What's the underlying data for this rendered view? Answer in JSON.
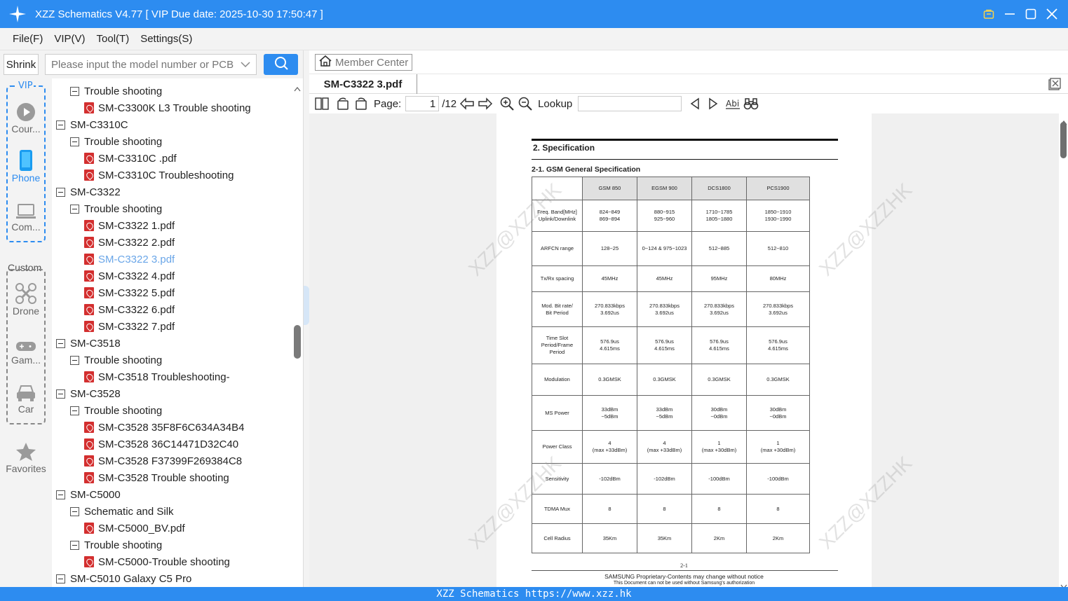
{
  "app": {
    "title": "XZZ Schematics V4.77 [ VIP Due date: 2025-10-30 17:50:47 ]"
  },
  "menu": [
    "File(F)",
    "VIP(V)",
    "Tool(T)",
    "Settings(S)"
  ],
  "search": {
    "shrink_label": "Shrink",
    "placeholder": "Please input the model number or PCB"
  },
  "sidebar": {
    "vip_label": "VIP",
    "custom_label": "Custom",
    "items": [
      {
        "label": "Cour...",
        "icon": "play-icon"
      },
      {
        "label": "Phone",
        "icon": "phone-icon"
      },
      {
        "label": "Com...",
        "icon": "laptop-icon"
      },
      {
        "label": "Drone",
        "icon": "drone-icon"
      },
      {
        "label": "Gam...",
        "icon": "gamepad-icon"
      },
      {
        "label": "Car",
        "icon": "car-icon"
      },
      {
        "label": "Favorites",
        "icon": "star-icon"
      }
    ]
  },
  "tree": [
    {
      "level": 1,
      "type": "folder",
      "label": "Trouble shooting"
    },
    {
      "level": 2,
      "type": "pdf",
      "label": "SM-C3300K L3 Trouble shooting"
    },
    {
      "level": 0,
      "type": "folder",
      "label": "SM-C3310C"
    },
    {
      "level": 1,
      "type": "folder",
      "label": "Trouble shooting"
    },
    {
      "level": 2,
      "type": "pdf",
      "label": "SM-C3310C .pdf"
    },
    {
      "level": 2,
      "type": "pdf",
      "label": "SM-C3310C Troubleshooting"
    },
    {
      "level": 0,
      "type": "folder",
      "label": "SM-C3322"
    },
    {
      "level": 1,
      "type": "folder",
      "label": "Trouble shooting"
    },
    {
      "level": 2,
      "type": "pdf",
      "label": "SM-C3322 1.pdf"
    },
    {
      "level": 2,
      "type": "pdf",
      "label": "SM-C3322 2.pdf"
    },
    {
      "level": 2,
      "type": "pdf",
      "label": "SM-C3322 3.pdf",
      "selected": true
    },
    {
      "level": 2,
      "type": "pdf",
      "label": "SM-C3322 4.pdf"
    },
    {
      "level": 2,
      "type": "pdf",
      "label": "SM-C3322 5.pdf"
    },
    {
      "level": 2,
      "type": "pdf",
      "label": "SM-C3322 6.pdf"
    },
    {
      "level": 2,
      "type": "pdf",
      "label": "SM-C3322 7.pdf"
    },
    {
      "level": 0,
      "type": "folder",
      "label": "SM-C3518"
    },
    {
      "level": 1,
      "type": "folder",
      "label": "Trouble shooting"
    },
    {
      "level": 2,
      "type": "pdf",
      "label": "SM-C3518 Troubleshooting-"
    },
    {
      "level": 0,
      "type": "folder",
      "label": "SM-C3528"
    },
    {
      "level": 1,
      "type": "folder",
      "label": "Trouble shooting"
    },
    {
      "level": 2,
      "type": "pdf",
      "label": "SM-C3528 35F8F6C634A34B4"
    },
    {
      "level": 2,
      "type": "pdf",
      "label": "SM-C3528 36C14471D32C40"
    },
    {
      "level": 2,
      "type": "pdf",
      "label": "SM-C3528 F37399F269384C8"
    },
    {
      "level": 2,
      "type": "pdf",
      "label": "SM-C3528 Trouble shooting"
    },
    {
      "level": 0,
      "type": "folder",
      "label": "SM-C5000"
    },
    {
      "level": 1,
      "type": "folder",
      "label": "Schematic and Silk"
    },
    {
      "level": 2,
      "type": "pdf",
      "label": "SM-C5000_BV.pdf"
    },
    {
      "level": 1,
      "type": "folder",
      "label": "Trouble shooting"
    },
    {
      "level": 2,
      "type": "pdf",
      "label": "SM-C5000-Trouble shooting"
    },
    {
      "level": 0,
      "type": "folder",
      "label": "SM-C5010 Galaxy C5 Pro"
    }
  ],
  "viewer": {
    "member_center": "Member Center",
    "tab_name": "SM-C3322 3.pdf",
    "page_label": "Page:",
    "page_current": "1",
    "page_total": "/12",
    "lookup_label": "Lookup"
  },
  "document": {
    "section": "2.  Specification",
    "subsection": "2-1.  GSM  General  Specification",
    "columns": [
      "",
      "GSM  850",
      "EGSM  900",
      "DCS1800",
      "PCS1900"
    ],
    "rows": [
      [
        "Freq.  Band[MHz]\nUplink/Downlink",
        "824~849\n869~894",
        "880~915\n925~960",
        "1710~1785\n1805~1880",
        "1850~1910\n1930~1990"
      ],
      [
        "ARFCN  range",
        "128~25",
        "0~124  &  975~1023",
        "512~885",
        "512~810"
      ],
      [
        "Tx/Rx  spacing",
        "45MHz",
        "45MHz",
        "95MHz",
        "80MHz"
      ],
      [
        "Mod.  Bit  rate/\nBit  Period",
        "270.833kbps\n3.692us",
        "270.833kbps\n3.692us",
        "270.833kbps\n3.692us",
        "270.833kbps\n3.692us"
      ],
      [
        "Time  Slot\nPeriod/Frame\nPeriod",
        "576.9us\n4.615ms",
        "576.9us\n4.615ms",
        "576.9us\n4.615ms",
        "576.9us\n4.615ms"
      ],
      [
        "Modulation",
        "0.3GMSK",
        "0.3GMSK",
        "0.3GMSK",
        "0.3GMSK"
      ],
      [
        "MS  Power",
        "33dBm\n~5dBm",
        "33dBm\n~5dBm",
        "30dBm\n~0dBm",
        "30dBm\n~0dBm"
      ],
      [
        "Power  Class",
        "4\n(max  +33dBm)",
        "4\n(max  +33dBm)",
        "1\n(max  +30dBm)",
        "1\n(max  +30dBm)"
      ],
      [
        "Sensitivity",
        "-102dBm",
        "-102dBm",
        "-100dBm",
        "-100dBm"
      ],
      [
        "TDMA  Mux",
        "8",
        "8",
        "8",
        "8"
      ],
      [
        "Cell  Radius",
        "35Km",
        "35Km",
        "2Km",
        "2Km"
      ]
    ],
    "page_number": "2-1",
    "footer1": "SAMSUNG Proprietary-Contents may change without notice",
    "footer2": "This  Document  can  not  be  used  without  Samsung's  authorization",
    "watermark": "XZZ@XZZHK"
  },
  "statusbar": "XZZ Schematics https://www.xzz.hk",
  "colors": {
    "accent": "#2d8cf0",
    "pdf_icon": "#d32f2f",
    "selected_text": "#6aa6e8"
  }
}
